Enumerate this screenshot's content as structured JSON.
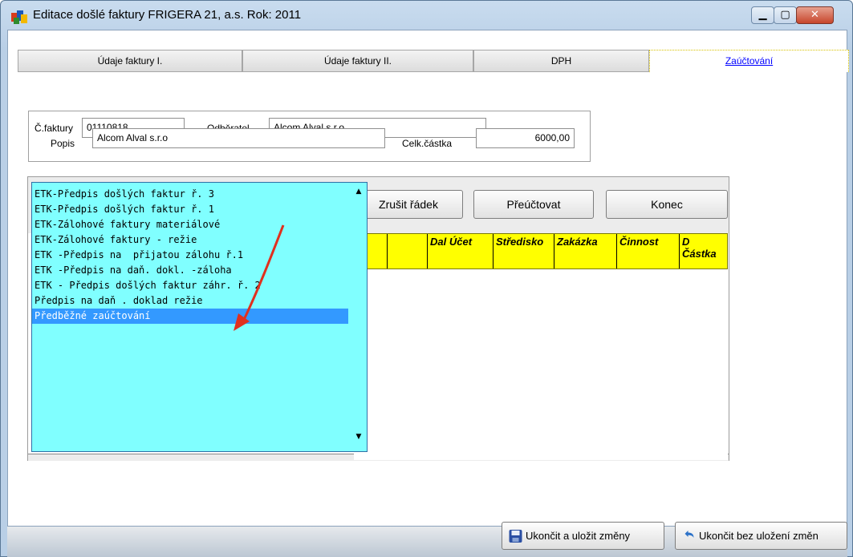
{
  "window": {
    "title": "Editace došlé faktury  FRIGERA 21, a.s.  Rok: 2011",
    "controls": {
      "minimize": "▁",
      "maximize": "▢",
      "close": "✕"
    }
  },
  "tabs": [
    {
      "label": "Údaje faktury I."
    },
    {
      "label": "Údaje faktury II."
    },
    {
      "label": "DPH"
    },
    {
      "label": "Zaúčtování",
      "active": true
    }
  ],
  "header": {
    "invoice_label": "Č.faktury",
    "invoice_value": "01110818",
    "customer_label": "Odběratel",
    "customer_value": "Alcom Alval s.r.o",
    "description_label": "Popis",
    "description_value": "Alcom Alval s.r.o",
    "total_label": "Celk.částka",
    "total_value": "6000,00"
  },
  "toolbar": {
    "delete_row": "Zrušit řádek",
    "reaccount": "Přeúčtovat",
    "end": "Konec"
  },
  "grid": {
    "columns": [
      "",
      "",
      "Dal Účet",
      "Středisko",
      "Zakázka",
      "Činnost",
      "D Částka"
    ]
  },
  "dropdown": {
    "items": [
      "ETK-Předpis došlých faktur ř. 3",
      "ETK-Předpis došlých faktur ř. 1",
      "ETK-Zálohové faktury materiálové",
      "ETK-Zálohové faktury - režie",
      "ETK -Předpis na  přijatou zálohu ř.1",
      "ETK -Předpis na daň. dokl. -záloha",
      "ETK - Předpis došlých faktur záhr. ř. 2",
      "Předpis na daň . doklad režie",
      "Předběžné zaúčtování"
    ],
    "selected": "Předběžné zaúčtování",
    "background": "#80ffff",
    "selection_color": "#3399ff"
  },
  "annotation": {
    "arrow_color": "#e0301e",
    "icon": "red-arrow-icon"
  },
  "footer": {
    "save_close": "Ukončit a uložit změny",
    "close_no_save": "Ukončit bez uložení změn"
  },
  "colors": {
    "grid_header": "#ffff00",
    "accent_link": "#0000ff"
  }
}
